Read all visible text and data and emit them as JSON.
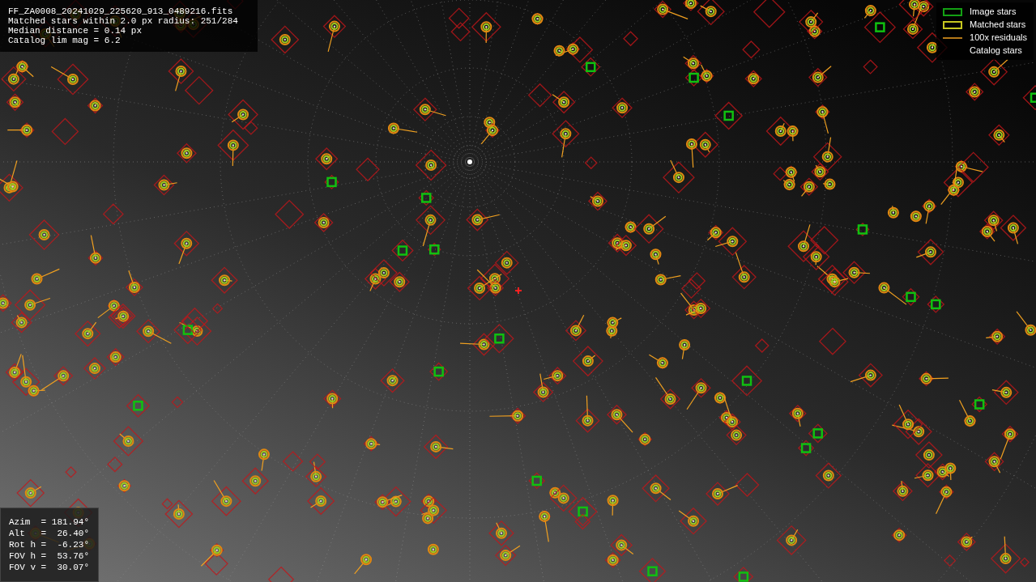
{
  "header_info": [
    "FF_ZA0008_20241029_225620_913_0489216.fits",
    "Matched stars within 2.0 px radius: 251/284",
    "Median distance = 0.14 px",
    "Catalog lim mag = 6.2"
  ],
  "legend": [
    {
      "kind": "image",
      "label": "Image stars"
    },
    {
      "kind": "matched",
      "label": "Matched stars"
    },
    {
      "kind": "residual",
      "label": "100x residuals"
    },
    {
      "kind": "catalog",
      "label": "Catalog stars"
    }
  ],
  "pointing_info": [
    "Azim  = 181.94°",
    "Alt   =  26.40°",
    "Rot h =  -6.23°",
    "FOV h =  53.76°",
    "FOV v =  30.07°"
  ]
}
